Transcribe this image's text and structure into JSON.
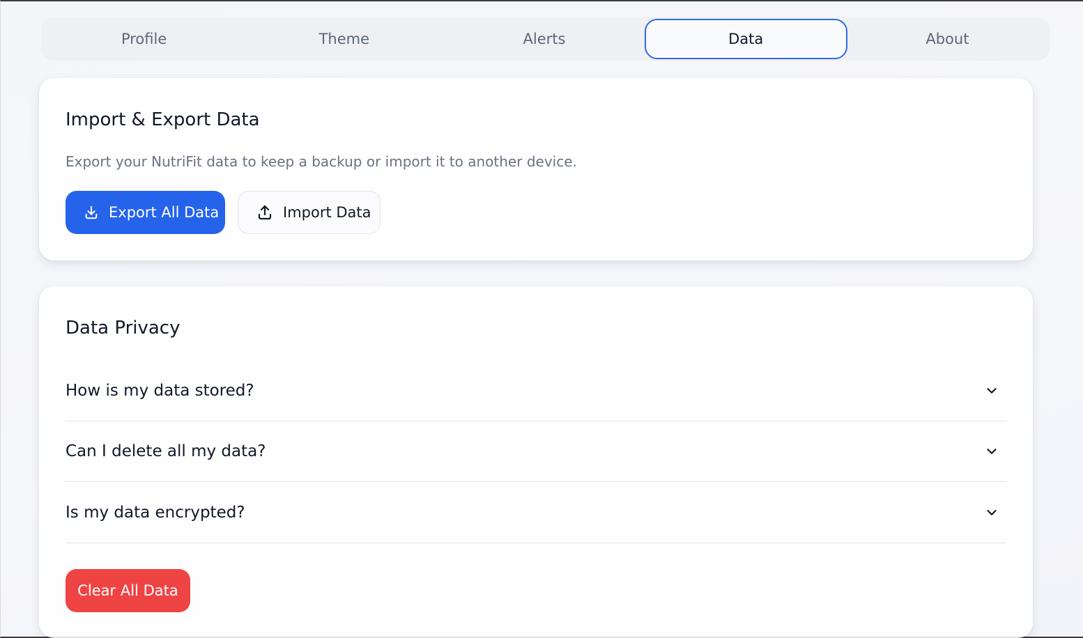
{
  "tabs": [
    {
      "label": "Profile",
      "active": false
    },
    {
      "label": "Theme",
      "active": false
    },
    {
      "label": "Alerts",
      "active": false
    },
    {
      "label": "Data",
      "active": true
    },
    {
      "label": "About",
      "active": false
    }
  ],
  "import_export": {
    "title": "Import & Export Data",
    "description": "Export your NutriFit data to keep a backup or import it to another device.",
    "export_label": "Export All Data",
    "export_icon": "download-icon",
    "import_label": "Import Data",
    "import_icon": "upload-icon"
  },
  "privacy": {
    "title": "Data Privacy",
    "faqs": [
      {
        "question": "How is my data stored?"
      },
      {
        "question": "Can I delete all my data?"
      },
      {
        "question": "Is my data encrypted?"
      }
    ],
    "clear_label": "Clear All Data"
  },
  "colors": {
    "accent": "#2563eb",
    "danger": "#ef4444",
    "active_tab_border": "#2f6ae6"
  }
}
